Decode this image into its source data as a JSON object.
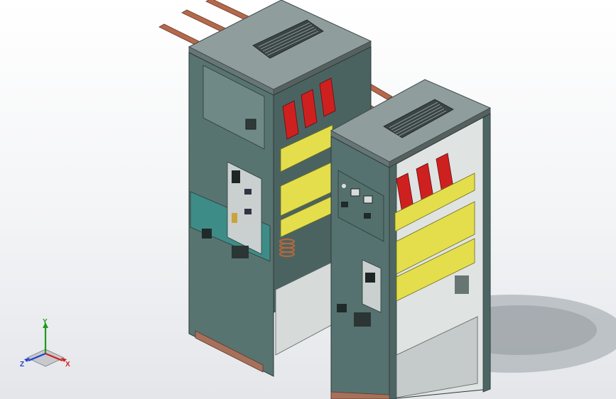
{
  "viewport": {
    "background_top": "#ffffff",
    "background_bottom": "#e4e6ea"
  },
  "model": {
    "colors": {
      "frame": "#5a7470",
      "frame_dark": "#3f524f",
      "panel": "#4f6b68",
      "panel_light": "#6c8783",
      "roof": "#8a9898",
      "roof_dark": "#6d7b7b",
      "busbar": "#b0664a",
      "breaker_red": "#cc1f1f",
      "insulator_yellow": "#e7e04a",
      "teal_band": "#3f8f8a",
      "shadow": "#9ea3a8"
    },
    "icons": [
      "left-switchgear-cabinet",
      "right-switchgear-cabinet",
      "copper-busbar",
      "vent-grille"
    ]
  },
  "triad": {
    "x_label": "X",
    "y_label": "Y",
    "z_label": "Z",
    "x_color": "#d21f1f",
    "y_color": "#1d9a1d",
    "z_color": "#1f3fd2"
  }
}
